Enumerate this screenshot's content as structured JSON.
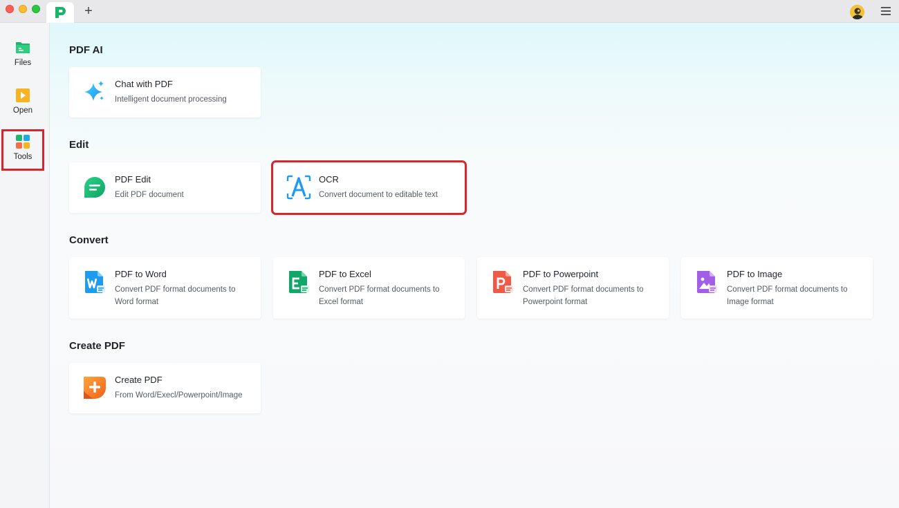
{
  "titlebar": {
    "new_tab_label": "+"
  },
  "sidebar": {
    "items": [
      {
        "label": "Files",
        "icon": "files-folder-icon"
      },
      {
        "label": "Open",
        "icon": "open-file-icon"
      },
      {
        "label": "Tools",
        "icon": "tools-grid-icon",
        "active": true
      }
    ]
  },
  "sections": [
    {
      "title": "PDF AI",
      "cards": [
        {
          "title": "Chat with PDF",
          "description": "Intelligent document processing",
          "icon": "sparkle-icon"
        }
      ]
    },
    {
      "title": "Edit",
      "cards": [
        {
          "title": "PDF Edit",
          "description": "Edit PDF document",
          "icon": "pdf-edit-icon"
        },
        {
          "title": "OCR",
          "description": "Convert document to editable text",
          "icon": "ocr-icon",
          "highlighted": true
        }
      ]
    },
    {
      "title": "Convert",
      "cards": [
        {
          "title": "PDF to Word",
          "description": "Convert PDF format documents to Word format",
          "icon": "word-icon"
        },
        {
          "title": "PDF to Excel",
          "description": "Convert PDF format documents to Excel format",
          "icon": "excel-icon"
        },
        {
          "title": "PDF to Powerpoint",
          "description": "Convert PDF format documents to Powerpoint format",
          "icon": "powerpoint-icon"
        },
        {
          "title": "PDF to Image",
          "description": "Convert PDF format documents to Image format",
          "icon": "image-icon"
        }
      ]
    },
    {
      "title": "Create PDF",
      "cards": [
        {
          "title": "Create PDF",
          "description": "From Word/Execl/Powerpoint/Image",
          "icon": "create-pdf-icon"
        }
      ]
    }
  ],
  "colors": {
    "accent_green": "#1db46a",
    "highlight_red": "#d6262e",
    "word_blue": "#1d9bf0",
    "excel_green": "#12a66a",
    "ppt_red": "#ee5a45",
    "image_purple": "#a35ee8",
    "create_orange": "#f57c1f"
  }
}
